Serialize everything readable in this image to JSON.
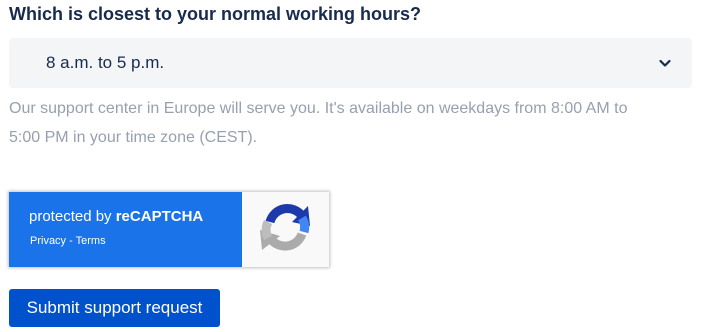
{
  "form": {
    "question": "Which is closest to your normal working hours?",
    "hours_select": {
      "value": "8 a.m. to 5 p.m."
    },
    "helper_line1": "Our support center in Europe will serve you. It's available on weekdays from 8:00 AM to",
    "helper_line2": "5:00 PM in your time zone (CEST).",
    "submit_label": "Submit support request"
  },
  "recaptcha": {
    "prefix": "protected by ",
    "brand": "reCAPTCHA",
    "privacy_label": "Privacy",
    "separator": " - ",
    "terms_label": "Terms"
  },
  "icons": {
    "select_chevron": "chevron-down-icon",
    "recaptcha_logo": "recaptcha-logo-icon"
  },
  "colors": {
    "text_primary": "#172b4d",
    "text_muted": "#97a0af",
    "select_bg": "#f4f5f7",
    "recaptcha_blue": "#1a73e8",
    "button_bg": "#0052cc"
  }
}
